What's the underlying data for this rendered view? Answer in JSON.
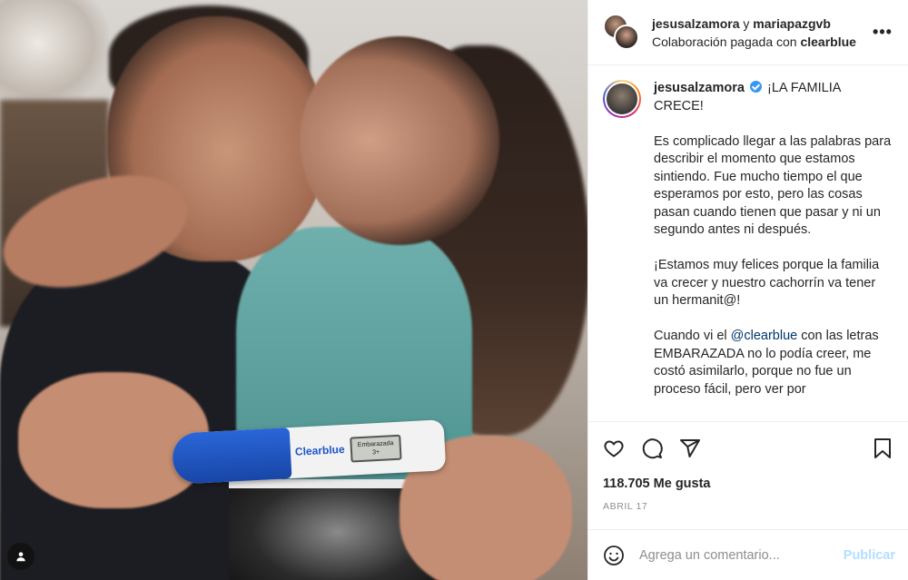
{
  "header": {
    "user1": "jesusalzamora",
    "connector": "y",
    "user2": "mariapazgvb",
    "collab_prefix": "Colaboración pagada con",
    "collab_brand": "clearblue",
    "more_label": "•••"
  },
  "caption": {
    "username": "jesusalzamora",
    "title": "¡LA FAMILIA CRECE!",
    "paragraph1": "Es complicado llegar a las palabras para describir el momento que estamos sintiendo. Fue mucho tiempo el que esperamos por esto, pero las cosas pasan cuando tienen que pasar y ni un segundo antes ni después.",
    "paragraph2": "¡Estamos muy felices porque la familia va crecer y nuestro cachorrín va tener un hermanit@!",
    "paragraph3_before": "Cuando vi el ",
    "paragraph3_mention": "@clearblue",
    "paragraph3_after": " con las letras EMBARAZADA no lo podía creer, me costó asimilarlo, porque no fue un proceso fácil, pero ver por"
  },
  "photo": {
    "test_brand": "Clearblue",
    "test_window_text": "Embarazada 3+"
  },
  "stats": {
    "likes": "118.705 Me gusta",
    "date": "ABRIL 17"
  },
  "comment": {
    "placeholder": "Agrega un comentario...",
    "publish_label": "Publicar"
  },
  "icons": {
    "like": "heart-icon",
    "comment": "comment-icon",
    "share": "share-icon",
    "save": "bookmark-icon",
    "emoji": "emoji-icon",
    "tag": "user-tag-icon",
    "verified": "verified-badge-icon"
  },
  "colors": {
    "link": "#00376b",
    "verified": "#3897f0",
    "publish_disabled": "#b2dffc",
    "muted": "#8e8e8e"
  }
}
